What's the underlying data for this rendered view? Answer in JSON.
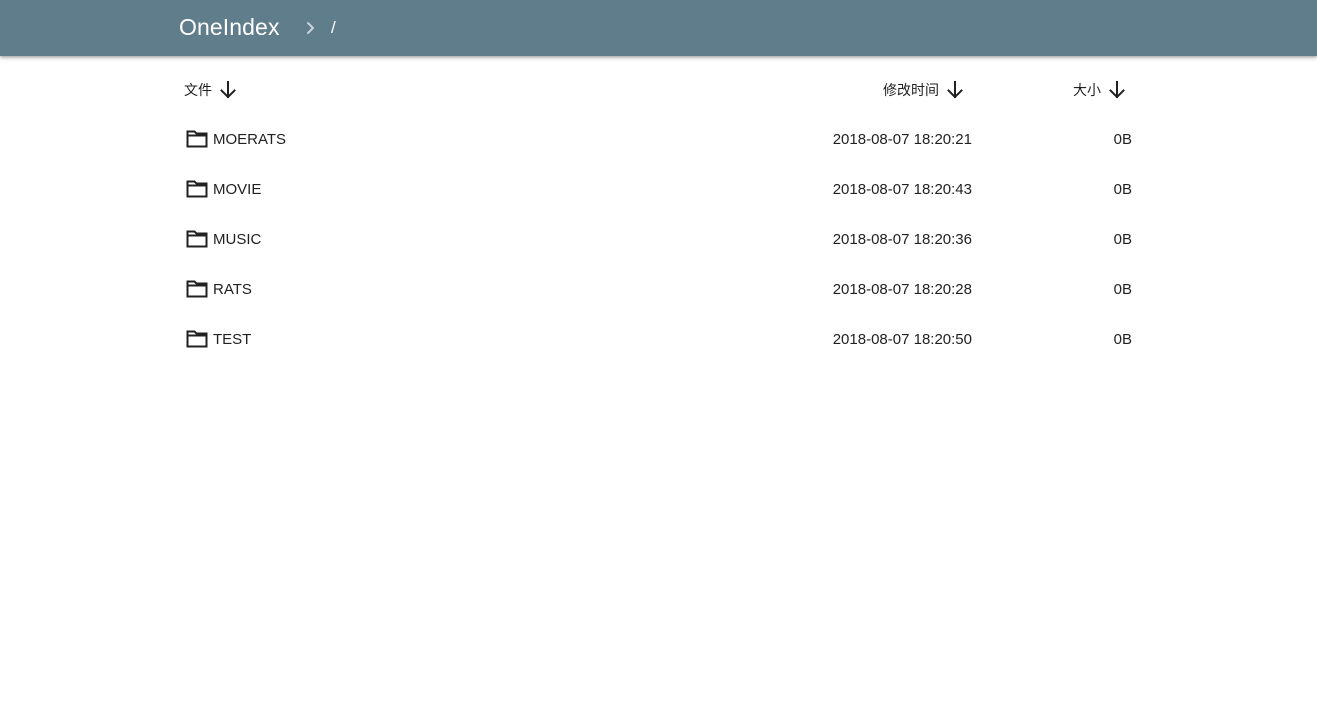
{
  "appbar": {
    "title": "OneIndex",
    "breadcrumb_separator_icon": "chevron-right-icon",
    "breadcrumb_root": "/",
    "background_color": "#607d8b"
  },
  "table": {
    "headers": {
      "name": "文件",
      "modified": "修改时间",
      "size": "大小",
      "sort_icon": "arrow-down-icon"
    },
    "rows": [
      {
        "icon": "folder-icon",
        "name": "MOERATS",
        "modified": "2018-08-07 18:20:21",
        "size": "0B"
      },
      {
        "icon": "folder-icon",
        "name": "MOVIE",
        "modified": "2018-08-07 18:20:43",
        "size": "0B"
      },
      {
        "icon": "folder-icon",
        "name": "MUSIC",
        "modified": "2018-08-07 18:20:36",
        "size": "0B"
      },
      {
        "icon": "folder-icon",
        "name": "RATS",
        "modified": "2018-08-07 18:20:28",
        "size": "0B"
      },
      {
        "icon": "folder-icon",
        "name": "TEST",
        "modified": "2018-08-07 18:20:50",
        "size": "0B"
      }
    ]
  }
}
